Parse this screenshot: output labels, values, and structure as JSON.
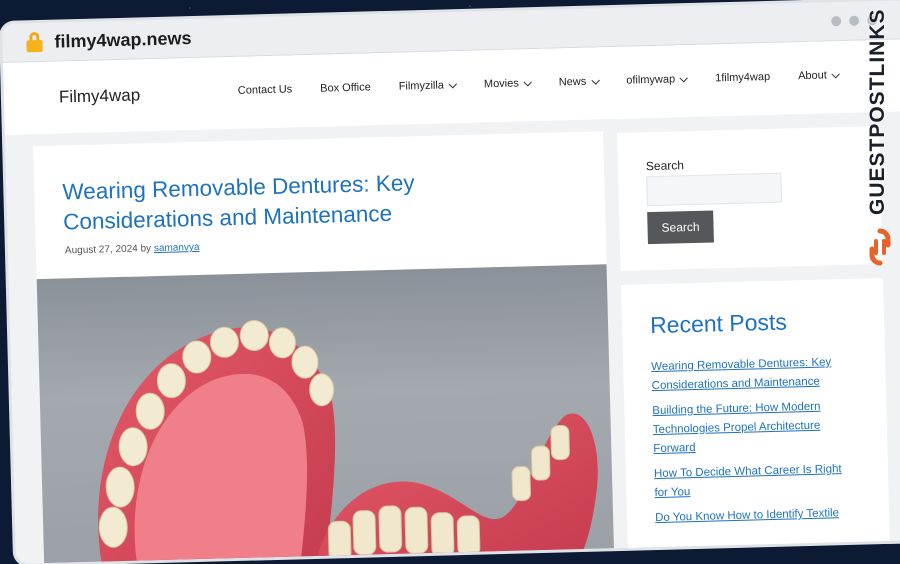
{
  "browser": {
    "url": "filmy4wap.news"
  },
  "site": {
    "logo": "Filmy4wap",
    "nav": [
      {
        "label": "Contact Us",
        "dropdown": false
      },
      {
        "label": "Box Office",
        "dropdown": false
      },
      {
        "label": "Filmyzilla",
        "dropdown": true
      },
      {
        "label": "Movies",
        "dropdown": true
      },
      {
        "label": "News",
        "dropdown": true
      },
      {
        "label": "ofilmywap",
        "dropdown": true
      },
      {
        "label": "1filmy4wap",
        "dropdown": false
      },
      {
        "label": "About",
        "dropdown": true
      }
    ]
  },
  "post": {
    "title": "Wearing Removable Dentures: Key Considerations and Maintenance",
    "date": "August 27, 2024",
    "by": "by",
    "author": "samanvya"
  },
  "sidebar": {
    "search": {
      "label": "Search",
      "button": "Search",
      "value": ""
    },
    "recent": {
      "title": "Recent Posts",
      "items": [
        "Wearing Removable Dentures: Key Considerations and Maintenance",
        "Building the Future: How Modern Technologies Propel Architecture Forward",
        "How To Decide What Career Is Right for You",
        "Do You Know How to Identify Textile"
      ]
    }
  },
  "watermark": {
    "text": "GUESTPOSTLINKS",
    "color": "#e8632b"
  },
  "colors": {
    "link": "#1e72bd",
    "button": "#55575b"
  }
}
